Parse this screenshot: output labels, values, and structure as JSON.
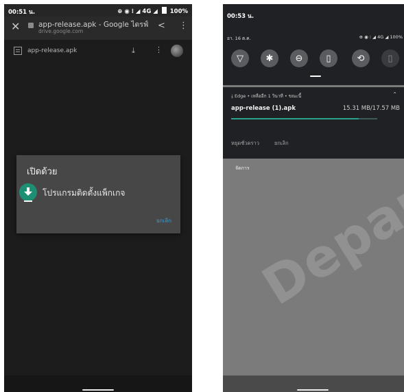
{
  "left": {
    "status_bar": {
      "time": "00:51 น.",
      "icons": "⊕ ◉ ⁝ ◢ 4G ◢",
      "battery": "100%"
    },
    "drive_header": {
      "title": "app-release.apk - Google ไดรฟ์",
      "subtitle": "drive.google.com",
      "icons": [
        "close-icon",
        "lock-icon",
        "share-icon",
        "more-vertical-icon"
      ]
    },
    "file_row": {
      "name": "app-release.apk",
      "icons": [
        "file-icon",
        "download-icon",
        "more-vertical-icon",
        "avatar"
      ]
    },
    "dialog": {
      "title": "เปิดด้วย",
      "option": "โปรแกรมติดตั้งแพ็กเกจ",
      "cancel": "ยกเลิก",
      "accent_color": "#1f8f74",
      "cancel_color": "#3d9bd0"
    }
  },
  "right": {
    "time": "00:53 น.",
    "date": "อา. 16 ต.ค.",
    "status_icons": "⊕ ◉ ⁝ ◢ 4G ◢ 100%",
    "quick_tiles": [
      {
        "name": "wifi-tile",
        "glyph": "▽"
      },
      {
        "name": "bluetooth-tile",
        "glyph": "✱"
      },
      {
        "name": "do-not-disturb-tile",
        "glyph": "⊖"
      },
      {
        "name": "flashlight-tile",
        "glyph": "▯"
      },
      {
        "name": "auto-rotate-tile",
        "glyph": "⟲"
      },
      {
        "name": "battery-saver-tile",
        "glyph": "▯"
      }
    ],
    "notification": {
      "header": "Edge • เหลืออีก 1 วินาที • ขณะนี้",
      "file_name": "app-release (1).apk",
      "size": "15.31 MB/17.57 MB",
      "progress": 0.871,
      "pause": "หยุดชั่วคราว",
      "cancel": "ยกเลิก",
      "accent_color": "#29a38c"
    },
    "manage": "จัดการ",
    "watermark": "Depar"
  }
}
